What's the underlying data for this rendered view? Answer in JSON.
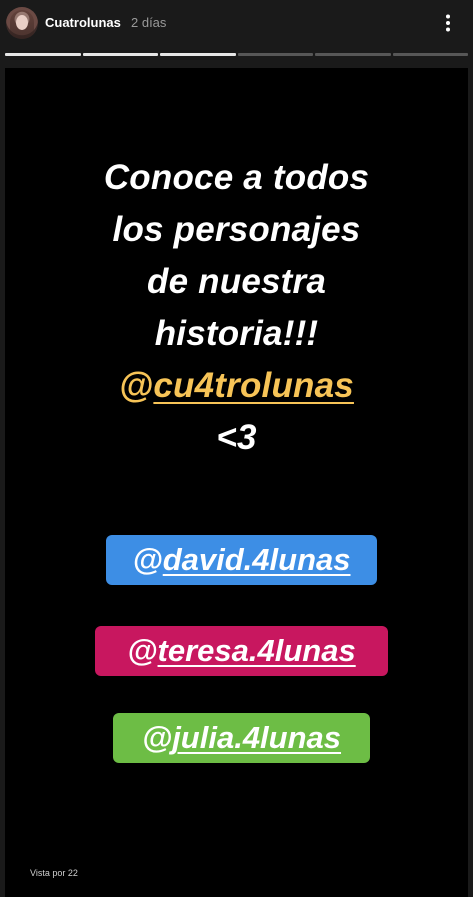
{
  "header": {
    "username": "Cuatrolunas",
    "time": "2 días",
    "more_icon": "more-vertical-icon",
    "avatar_icon": "profile-avatar"
  },
  "progress": {
    "segments_total": 6,
    "segments_done": 3
  },
  "story": {
    "headline": [
      "Conoce a todos",
      "los personajes",
      "de nuestra",
      "historia!!!"
    ],
    "main_mention_at": "@",
    "main_mention_name": "cu4trolunas",
    "heart": "<3",
    "mentions": [
      {
        "at": "@",
        "name": "david.4lunas",
        "color": "#3d8ee5"
      },
      {
        "at": "@",
        "name": "teresa.4lunas",
        "color": "#c8175f"
      },
      {
        "at": "@",
        "name": "julia.4lunas",
        "color": "#6dbd45"
      }
    ],
    "viewers": "Vista por 22"
  },
  "colors": {
    "background": "#1a1a1a",
    "story_bg": "#000000",
    "mention_highlight": "#f7c457"
  }
}
